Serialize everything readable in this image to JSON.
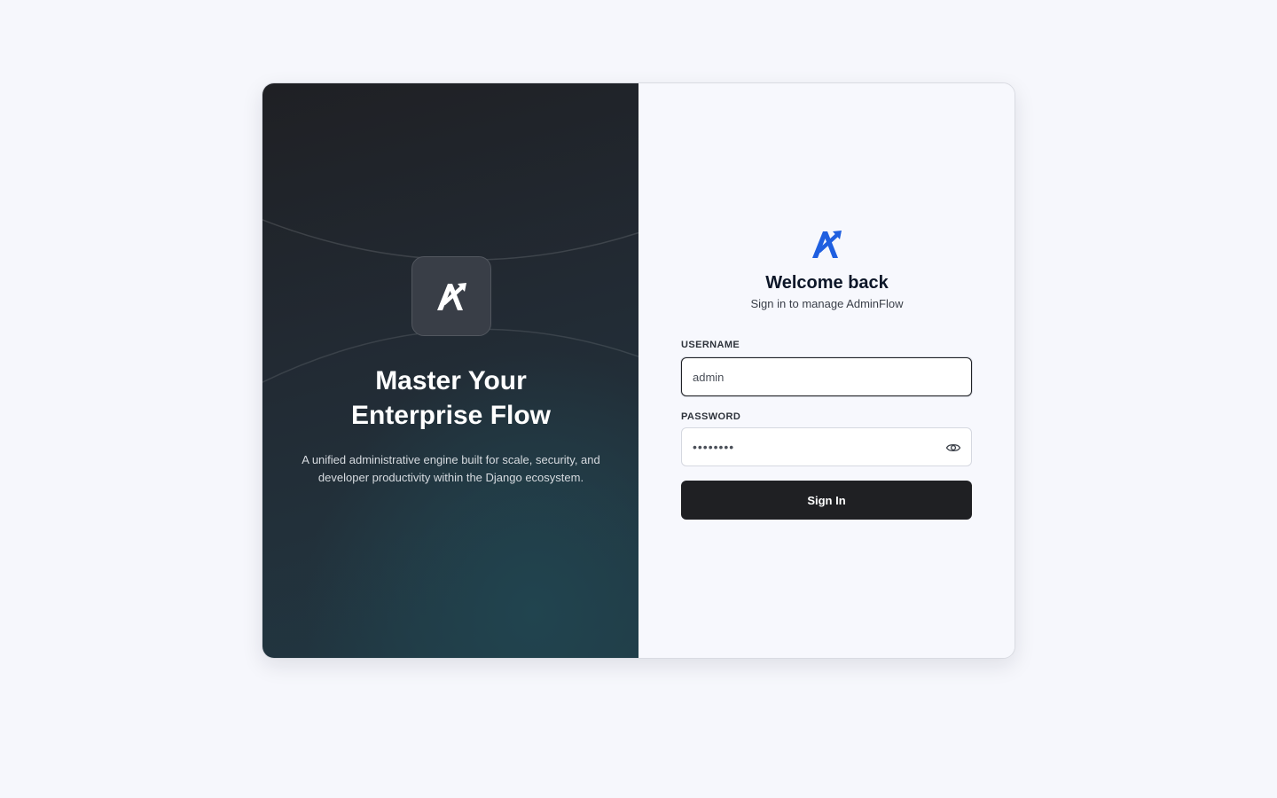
{
  "hero": {
    "logo_icon": "adminflow-logo-icon",
    "title_line1": "Master Your",
    "title_line2": "Enterprise Flow",
    "description": "A unified administrative engine built for scale, security, and developer productivity within the Django ecosystem."
  },
  "login": {
    "brand_icon": "adminflow-logo-icon",
    "brand_color": "#1f5fe0",
    "title": "Welcome back",
    "subtitle": "Sign in to manage AdminFlow",
    "username": {
      "label": "USERNAME",
      "value": "admin"
    },
    "password": {
      "label": "PASSWORD",
      "value": "password",
      "toggle_icon": "eye-icon"
    },
    "submit_label": "Sign In"
  },
  "colors": {
    "page_background": "#f6f7fc",
    "button": "#1f2023",
    "accent": "#1f5fe0"
  }
}
